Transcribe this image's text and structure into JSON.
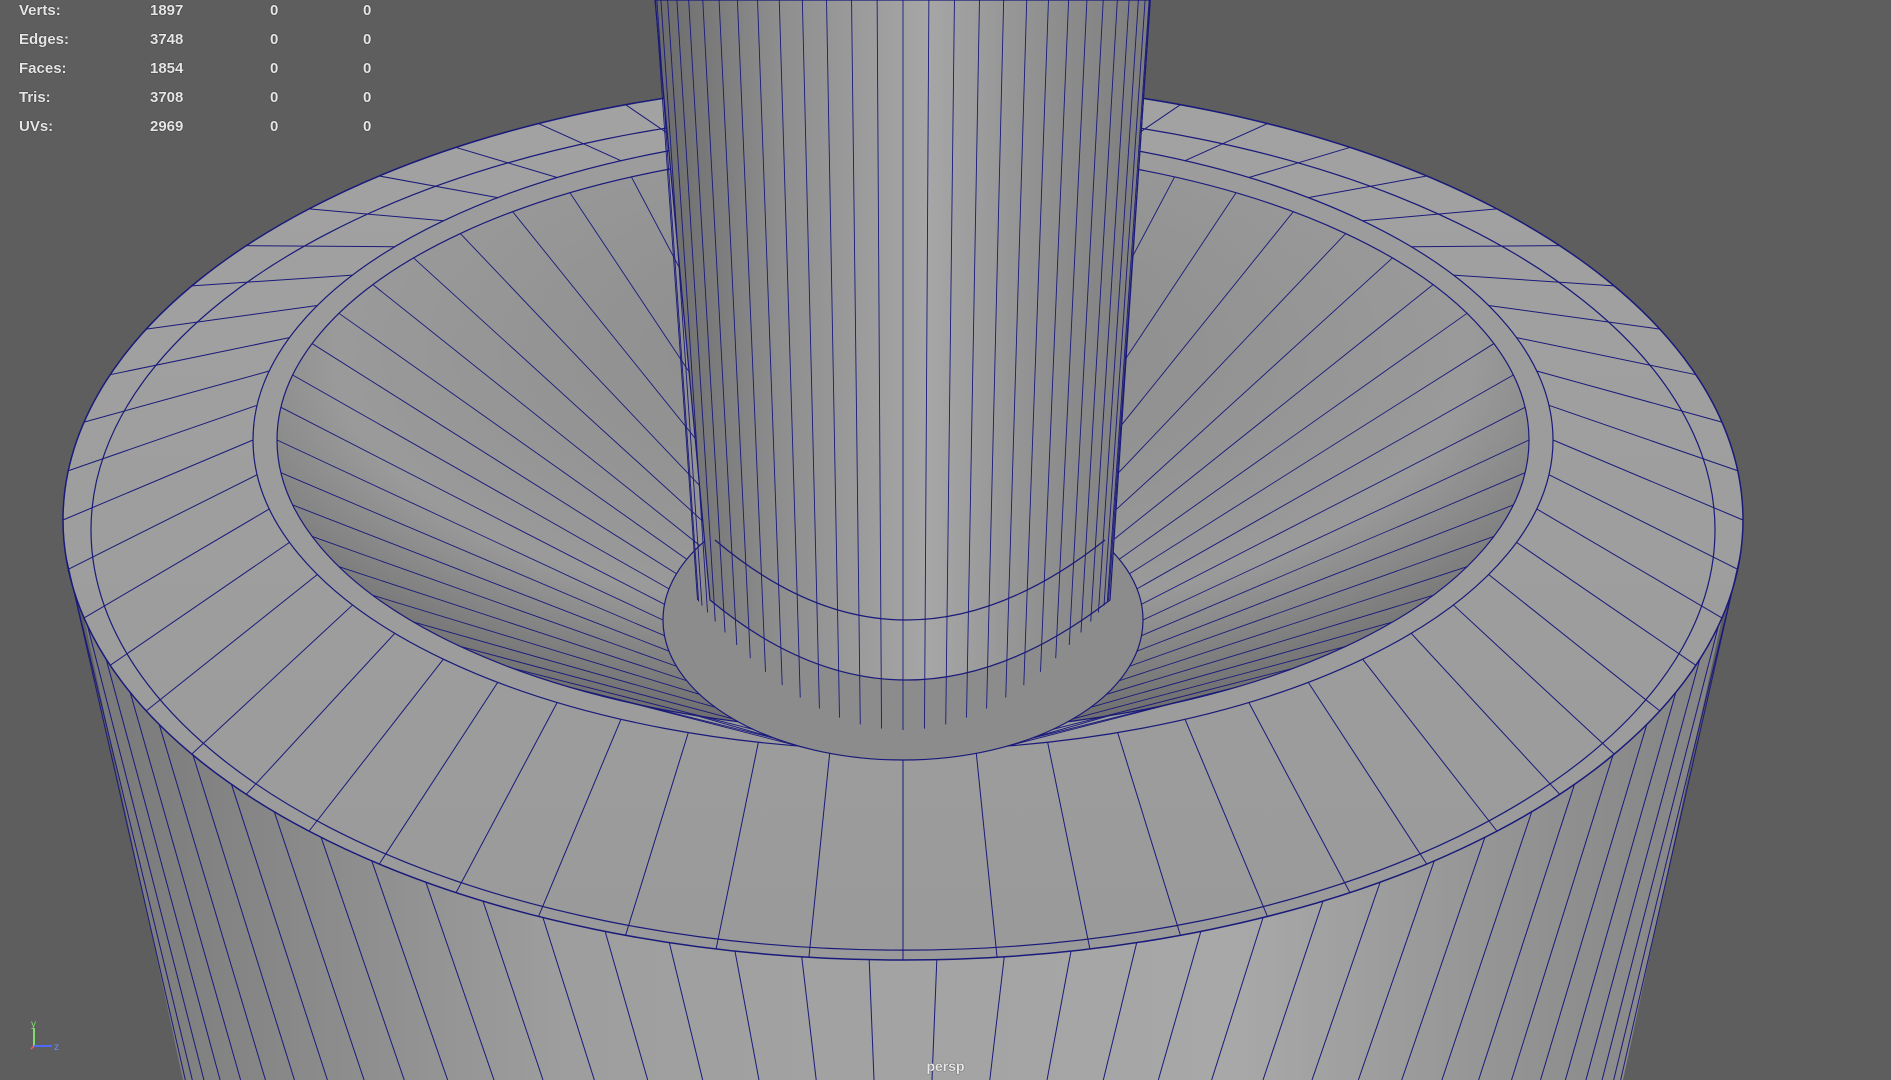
{
  "hud": {
    "rows": [
      {
        "label": "Verts:",
        "total": "1897",
        "selected": "0",
        "other": "0"
      },
      {
        "label": "Edges:",
        "total": "3748",
        "selected": "0",
        "other": "0"
      },
      {
        "label": "Faces:",
        "total": "1854",
        "selected": "0",
        "other": "0"
      },
      {
        "label": "Tris:",
        "total": "3708",
        "selected": "0",
        "other": "0"
      },
      {
        "label": "UVs:",
        "total": "2969",
        "selected": "0",
        "other": "0"
      }
    ]
  },
  "viewport": {
    "camera": "persp",
    "background_color": "#5e5e5e",
    "wire_color": "#1a1a7a"
  },
  "gizmo": {
    "axes": [
      "y",
      "z"
    ]
  }
}
